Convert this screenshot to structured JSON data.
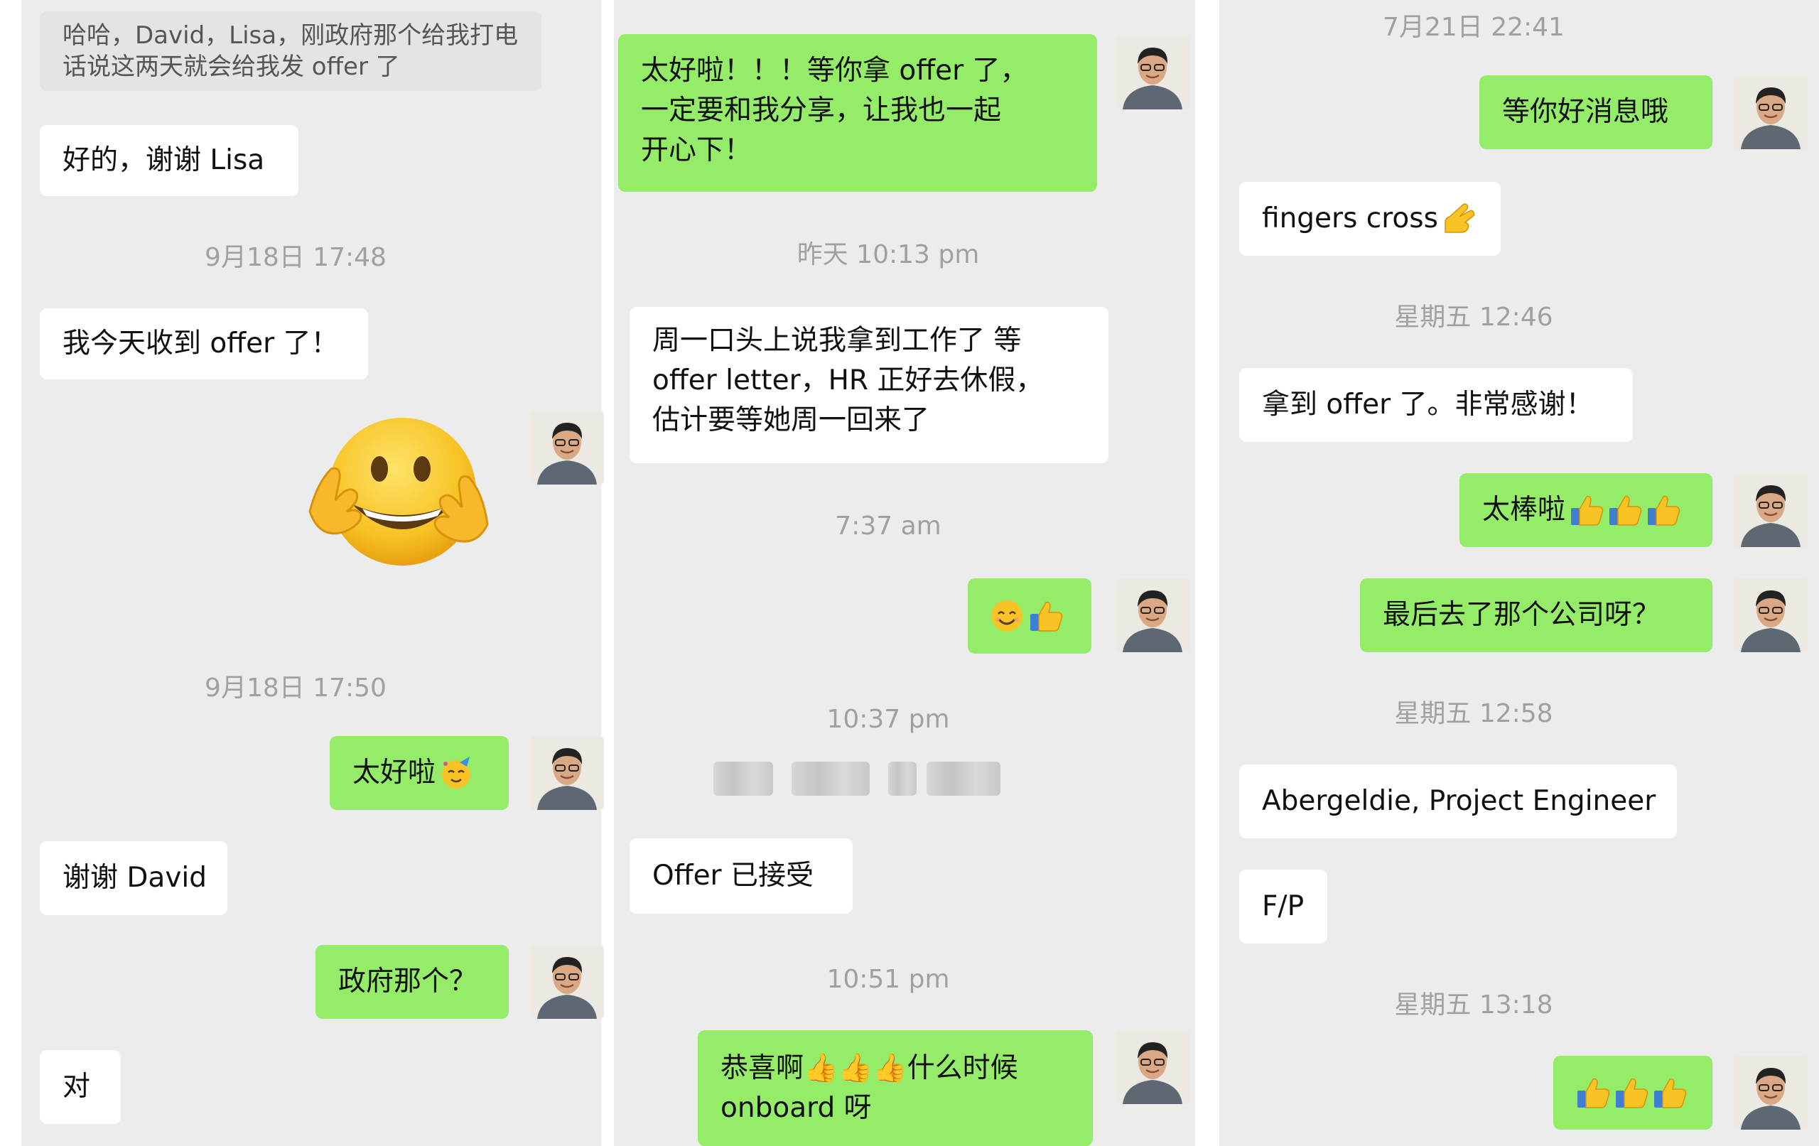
{
  "columns": [
    {
      "messages": [
        {
          "side": "in",
          "kind": "quote",
          "text": "哈哈，David，Lisa，刚政府那个给我打电话说这两天就会给我发 offer 了"
        },
        {
          "side": "in",
          "text": "好的，谢谢 Lisa"
        },
        {
          "kind": "time",
          "text": "9月18日 17:48"
        },
        {
          "side": "in",
          "text": "我今天收到 offer 了！"
        },
        {
          "side": "out",
          "kind": "sticker",
          "sticker": "hugging-face-sticker"
        },
        {
          "kind": "time",
          "text": "9月18日 17:50"
        },
        {
          "side": "out",
          "text": "太好啦",
          "emoji": [
            "party-face"
          ]
        },
        {
          "side": "in",
          "text": "谢谢 David"
        },
        {
          "side": "out",
          "text": "政府那个？"
        },
        {
          "side": "in",
          "text": "对"
        }
      ]
    },
    {
      "messages": [
        {
          "side": "out",
          "lines": [
            "太好啦！！！等你拿 offer 了，",
            "一定要和我分享，让我也一起",
            "开心下！"
          ]
        },
        {
          "kind": "time",
          "text": "昨天 10:13 pm"
        },
        {
          "side": "in",
          "lines": [
            "周一口头上说我拿到工作了 等",
            "offer letter，HR 正好去休假，",
            "估计要等她周一回来了"
          ]
        },
        {
          "kind": "time",
          "text": "7:37 am"
        },
        {
          "side": "out",
          "text": "",
          "emoji": [
            "smile",
            "thumbs-up"
          ]
        },
        {
          "kind": "time",
          "text": "10:37 pm"
        },
        {
          "kind": "redacted"
        },
        {
          "side": "in",
          "text": "Offer 已接受"
        },
        {
          "kind": "time",
          "text": "10:51 pm"
        },
        {
          "side": "out",
          "lines": [
            "恭喜啊👍👍👍什么时候",
            "onboard 呀"
          ]
        }
      ]
    },
    {
      "messages": [
        {
          "kind": "time",
          "text": "7月21日 22:41"
        },
        {
          "side": "out",
          "text": "等你好消息哦"
        },
        {
          "side": "in",
          "text": "fingers cross",
          "emoji": [
            "crossed-fingers"
          ]
        },
        {
          "kind": "time",
          "text": "星期五 12:46"
        },
        {
          "side": "in",
          "text": "拿到 offer 了。非常感谢！"
        },
        {
          "side": "out",
          "text": "太棒啦",
          "emoji": [
            "thumbs-up",
            "thumbs-up",
            "thumbs-up"
          ]
        },
        {
          "side": "out",
          "text": "最后去了那个公司呀？"
        },
        {
          "kind": "time",
          "text": "星期五 12:58"
        },
        {
          "side": "in",
          "text": "Abergeldie, Project Engineer"
        },
        {
          "side": "in",
          "text": "F/P"
        },
        {
          "kind": "time",
          "text": "星期五 13:18"
        },
        {
          "side": "out",
          "text": "",
          "emoji": [
            "thumbs-up",
            "thumbs-up",
            "thumbs-up"
          ]
        }
      ]
    }
  ],
  "colors": {
    "incoming_bubble": "#ffffff",
    "outgoing_bubble": "#95ec69",
    "chat_background": "#ececec",
    "timestamp": "#a0a0a0"
  },
  "avatar_icon": "user-avatar-photo"
}
